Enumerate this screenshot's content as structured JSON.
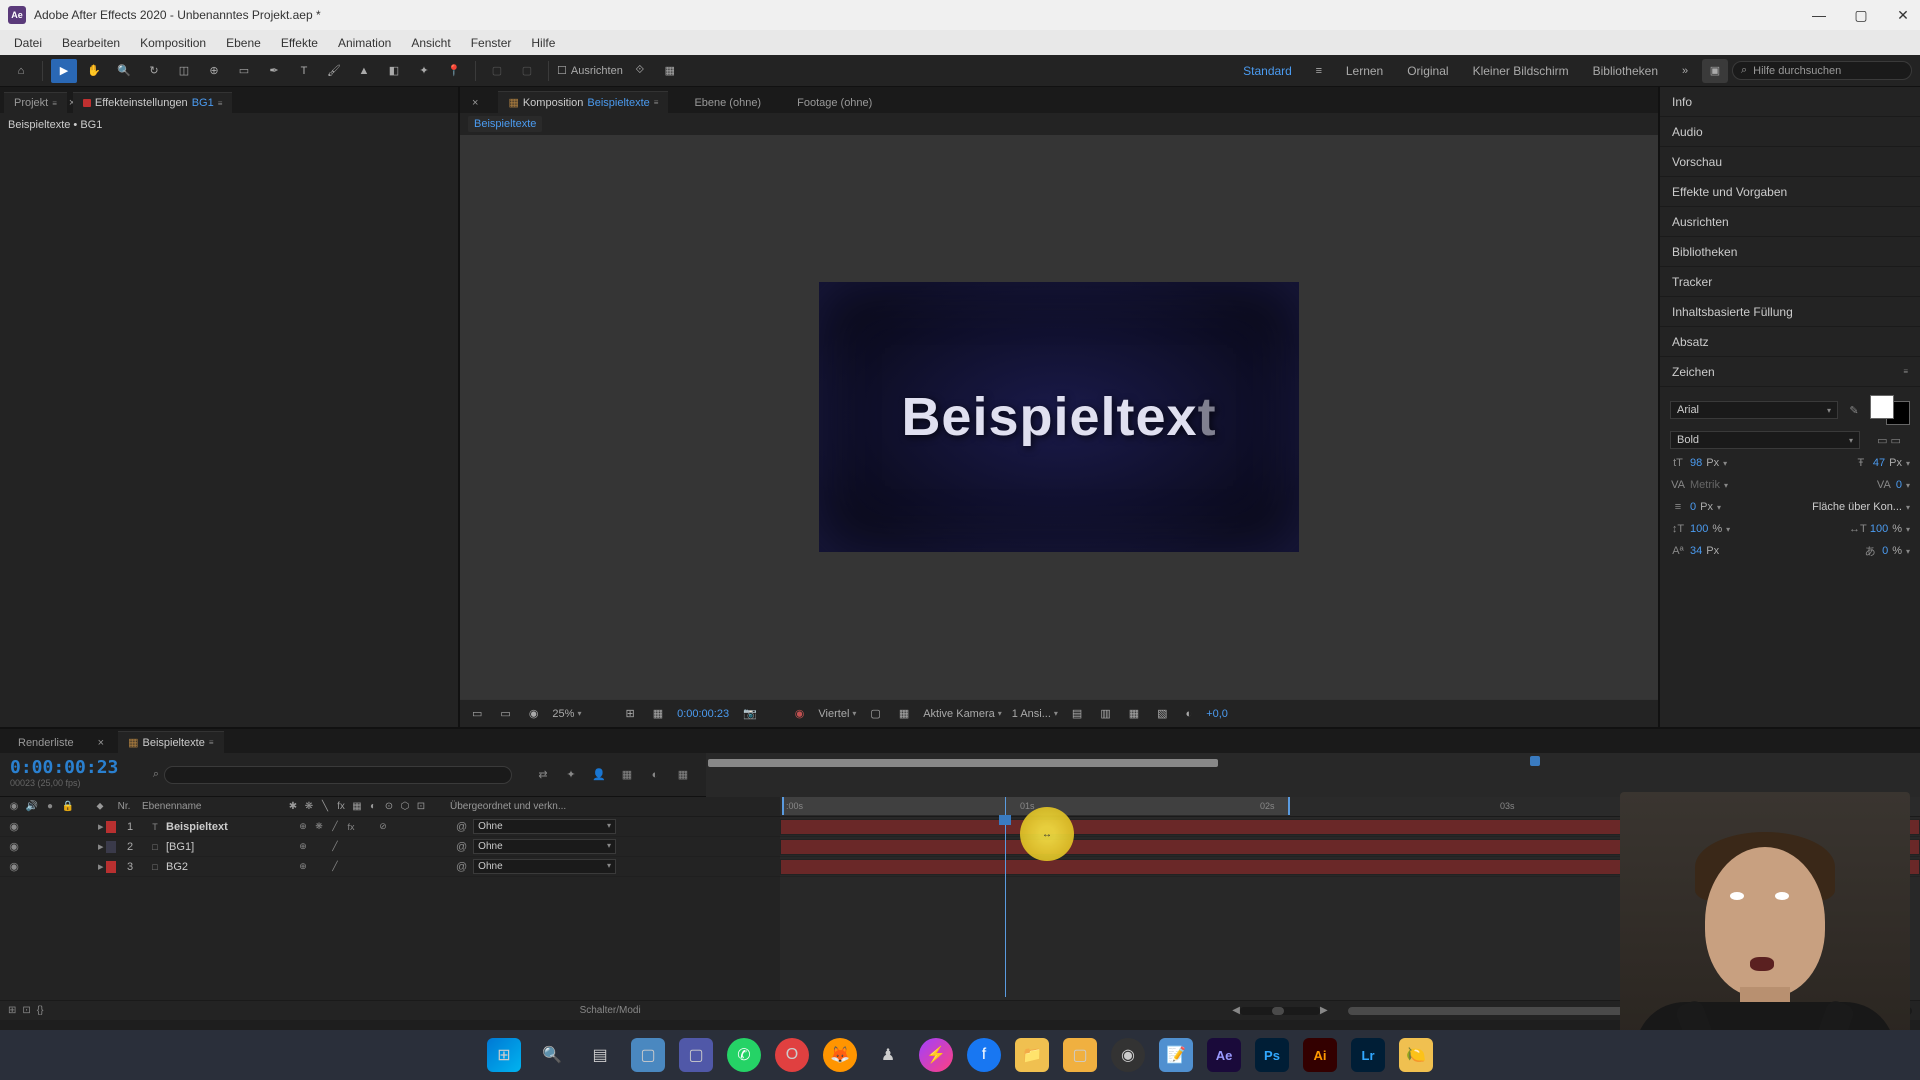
{
  "titlebar": {
    "icon": "Ae",
    "text": "Adobe After Effects 2020 - Unbenanntes Projekt.aep *"
  },
  "menu": [
    "Datei",
    "Bearbeiten",
    "Komposition",
    "Ebene",
    "Effekte",
    "Animation",
    "Ansicht",
    "Fenster",
    "Hilfe"
  ],
  "toolbar": {
    "ausrichten": "Ausrichten",
    "workspaces": [
      "Standard",
      "Lernen",
      "Original",
      "Kleiner Bildschirm",
      "Bibliotheken"
    ],
    "search_placeholder": "Hilfe durchsuchen"
  },
  "project_panel": {
    "tab_projekt": "Projekt",
    "tab_effekt": "Effekteinstellungen",
    "tab_effekt_name": "BG1",
    "content_line": "Beispieltexte • BG1"
  },
  "comp_panel": {
    "tab_komp": "Komposition",
    "tab_komp_name": "Beispieltexte",
    "tab_ebene": "Ebene  (ohne)",
    "tab_footage": "Footage  (ohne)",
    "breadcrumb": "Beispieltexte",
    "preview_text_bold": "Beispieltex",
    "preview_text_dim": "t"
  },
  "comp_footer": {
    "zoom": "25%",
    "time": "0:00:00:23",
    "resolution": "Viertel",
    "camera": "Aktive Kamera",
    "views": "1 Ansi...",
    "exposure": "+0,0"
  },
  "right_panels": [
    "Info",
    "Audio",
    "Vorschau",
    "Effekte und Vorgaben",
    "Ausrichten",
    "Bibliotheken",
    "Tracker",
    "Inhaltsbasierte Füllung",
    "Absatz"
  ],
  "char_panel": {
    "title": "Zeichen",
    "font": "Arial",
    "style": "Bold",
    "size": "98",
    "leading": "47",
    "kerning": "Metrik",
    "tracking": "0",
    "stroke": "0",
    "fill_over": "Fläche über Kon...",
    "vscale": "100",
    "hscale": "100",
    "baseline": "34",
    "tsume": "0",
    "px": "Px",
    "pct": "%"
  },
  "timeline": {
    "tab_render": "Renderliste",
    "tab_comp": "Beispieltexte",
    "timecode": "0:00:00:23",
    "timecode_sub": "00023 (25,00 fps)",
    "col_nr": "Nr.",
    "col_name": "Ebenenname",
    "col_parent": "Übergeordnet und verkn...",
    "parent_none": "Ohne",
    "ruler": {
      "t00": ":00s",
      "t01": "01s",
      "t02": "02s",
      "t03": "03s"
    },
    "layers": [
      {
        "num": "1",
        "name": "Beispieltext",
        "bold": true,
        "color": "red",
        "type": "T"
      },
      {
        "num": "2",
        "name": "[BG1]",
        "bold": false,
        "color": "dark",
        "type": "□"
      },
      {
        "num": "3",
        "name": "BG2",
        "bold": false,
        "color": "red",
        "type": "□"
      }
    ],
    "footer_center": "Schalter/Modi"
  }
}
